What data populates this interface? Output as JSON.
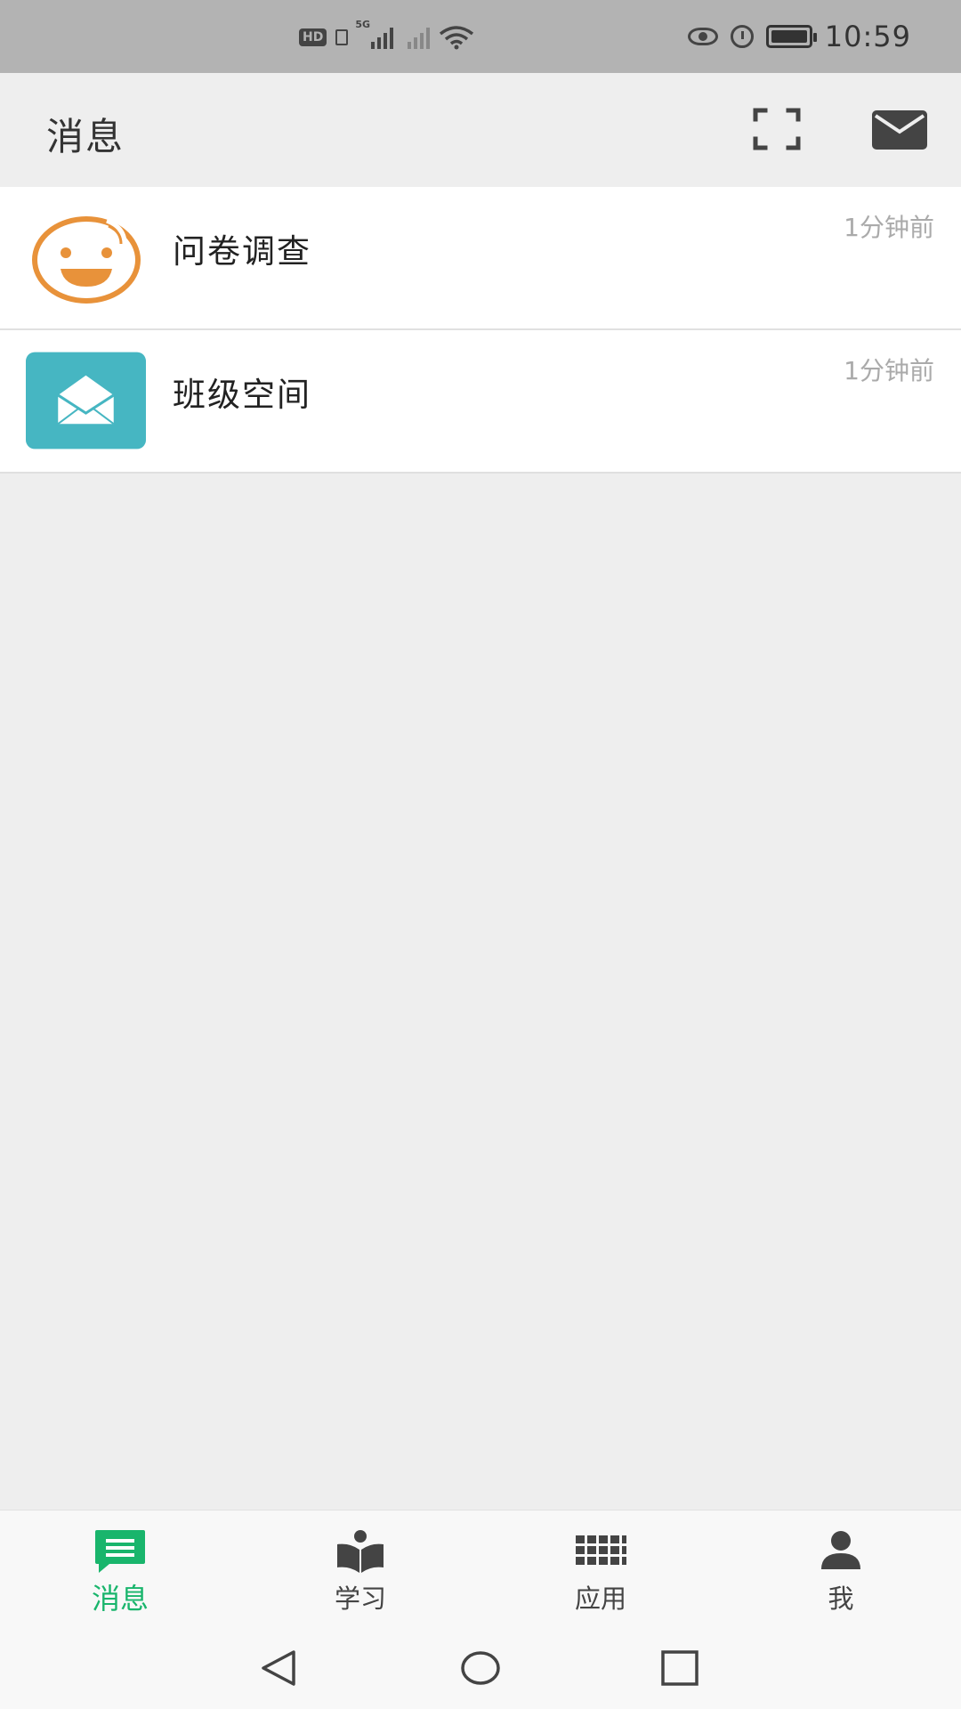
{
  "status_bar": {
    "time": "10:59",
    "hd_label": "HD",
    "network_label": "5G",
    "icons": [
      "hd-icon",
      "sim-icon",
      "signal-5g-icon",
      "signal-no-sim-icon",
      "wifi-icon",
      "eye-comfort-icon",
      "alarm-icon",
      "battery-icon"
    ]
  },
  "header": {
    "title": "消息",
    "actions": [
      "scan-icon",
      "mail-icon"
    ]
  },
  "messages": [
    {
      "title": "问卷调查",
      "time": "1分钟前",
      "icon": "smiley-icon",
      "accent": "#e8923a"
    },
    {
      "title": "班级空间",
      "time": "1分钟前",
      "icon": "envelope-icon",
      "accent": "#46b6c2"
    }
  ],
  "tabs": [
    {
      "label": "消息",
      "icon": "chat-icon",
      "active": true
    },
    {
      "label": "学习",
      "icon": "book-reader-icon",
      "active": false
    },
    {
      "label": "应用",
      "icon": "apps-grid-icon",
      "active": false
    },
    {
      "label": "我",
      "icon": "person-icon",
      "active": false
    }
  ],
  "colors": {
    "active_tab": "#19b56c",
    "status_bar_bg": "#b3b3b3",
    "page_bg": "#eeeeee"
  },
  "system_nav": [
    "back-icon",
    "home-icon",
    "recents-icon"
  ]
}
